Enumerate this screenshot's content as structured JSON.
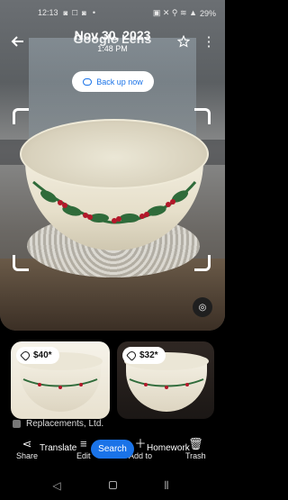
{
  "status_bar": {
    "time": "12:13",
    "left_icons": "◙ ☐ ◙",
    "right_icons": "▣ ✕ ⚲ ≋ ▲",
    "battery": "29%"
  },
  "header": {
    "background_title": "Google Lens",
    "date": "Nov 30, 2023",
    "time": "1:48 PM",
    "backup_label": "Back up now"
  },
  "results": {
    "items": [
      {
        "price": "$40*"
      },
      {
        "price": "$32*"
      }
    ],
    "source_label": "Replacements, Ltd."
  },
  "lens_chips": {
    "translate": "Translate",
    "search": "Search",
    "homework": "Homework"
  },
  "actions": {
    "share": "Share",
    "edit": "Edit",
    "add_to": "Add to",
    "trash": "Trash"
  },
  "colors": {
    "accent": "#1a73e8",
    "holly_green": "#2f6b3a",
    "berry_red": "#b3182a"
  },
  "icons": {
    "back": "arrow-left",
    "star": "star-outline",
    "more": "more-vert",
    "cloud": "cloud-upload",
    "lens": "lens",
    "tag": "price-tag",
    "share": "share",
    "edit": "edit-sliders",
    "add_to": "add-to",
    "trash": "trash"
  }
}
